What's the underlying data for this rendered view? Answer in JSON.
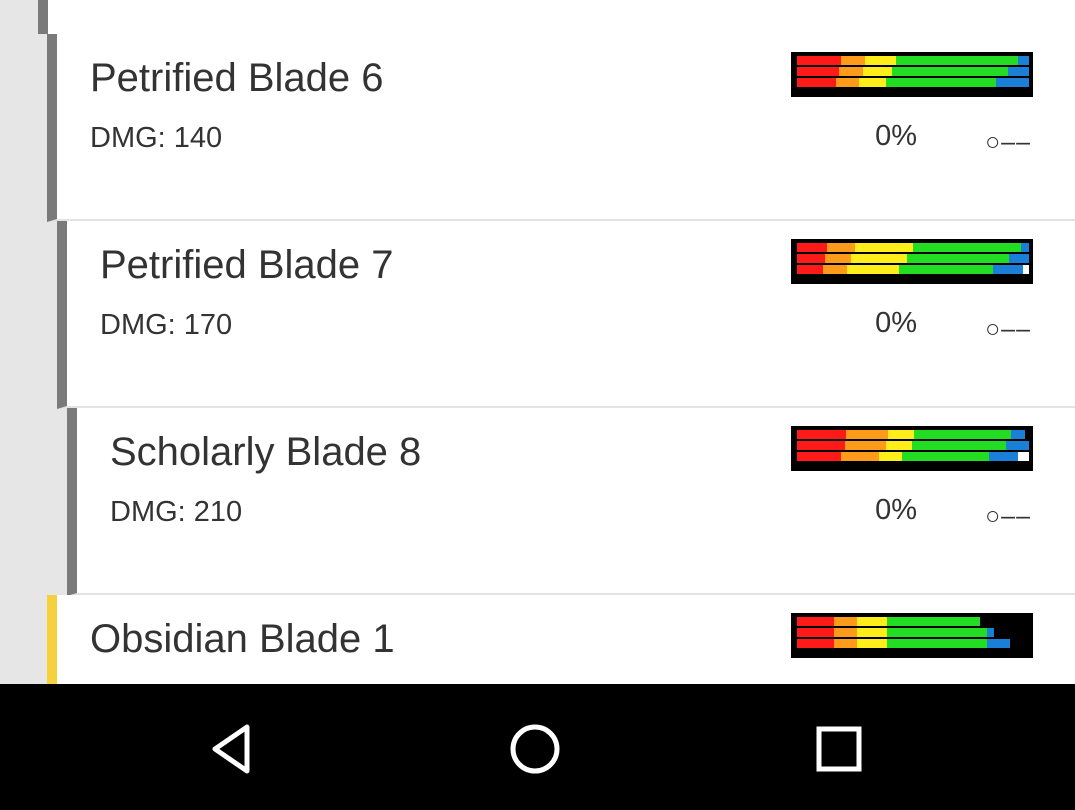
{
  "colors": {
    "red": "#ff1a1a",
    "orange": "#ff9b1a",
    "yellow": "#ffee1a",
    "green": "#22dd22",
    "blue": "#1a7fd6",
    "white": "#ffffff",
    "border_gray": "#7a7a7a",
    "border_yellow": "#f5d23d"
  },
  "items": [
    {
      "name": "Petrified Blade 6",
      "damage": "DMG: 140",
      "percent": "0%",
      "state": "○––",
      "bars": [
        [
          [
            "red",
            0.2
          ],
          [
            "orange",
            0.11
          ],
          [
            "yellow",
            0.14
          ],
          [
            "green",
            0.55
          ],
          [
            "blue",
            0.05
          ]
        ],
        [
          [
            "red",
            0.2
          ],
          [
            "orange",
            0.11
          ],
          [
            "yellow",
            0.14
          ],
          [
            "green",
            0.55
          ],
          [
            "blue",
            0.1
          ]
        ],
        [
          [
            "red",
            0.2
          ],
          [
            "orange",
            0.11
          ],
          [
            "yellow",
            0.14
          ],
          [
            "green",
            0.55
          ],
          [
            "blue",
            0.17
          ]
        ]
      ]
    },
    {
      "name": "Petrified Blade 7",
      "damage": "DMG: 170",
      "percent": "0%",
      "state": "○––",
      "bars": [
        [
          [
            "red",
            0.14
          ],
          [
            "orange",
            0.13
          ],
          [
            "yellow",
            0.27
          ],
          [
            "green",
            0.5
          ],
          [
            "blue",
            0.04
          ]
        ],
        [
          [
            "red",
            0.14
          ],
          [
            "orange",
            0.13
          ],
          [
            "yellow",
            0.27
          ],
          [
            "green",
            0.5
          ],
          [
            "blue",
            0.1
          ]
        ],
        [
          [
            "red",
            0.14
          ],
          [
            "orange",
            0.13
          ],
          [
            "yellow",
            0.27
          ],
          [
            "green",
            0.5
          ],
          [
            "blue",
            0.16
          ],
          [
            "white",
            0.03
          ]
        ]
      ]
    },
    {
      "name": "Scholarly Blade 8",
      "damage": "DMG: 210",
      "percent": "0%",
      "state": "○––",
      "bars": [
        [
          [
            "red",
            0.21
          ],
          [
            "orange",
            0.18
          ],
          [
            "yellow",
            0.11
          ],
          [
            "green",
            0.42
          ],
          [
            "blue",
            0.06
          ]
        ],
        [
          [
            "red",
            0.21
          ],
          [
            "orange",
            0.18
          ],
          [
            "yellow",
            0.11
          ],
          [
            "green",
            0.42
          ],
          [
            "blue",
            0.1
          ]
        ],
        [
          [
            "red",
            0.21
          ],
          [
            "orange",
            0.18
          ],
          [
            "yellow",
            0.11
          ],
          [
            "green",
            0.42
          ],
          [
            "blue",
            0.14
          ],
          [
            "white",
            0.05
          ]
        ]
      ]
    },
    {
      "name": "Obsidian Blade 1",
      "damage": "",
      "percent": "",
      "state": "",
      "bars": [
        [
          [
            "red",
            0.16
          ],
          [
            "orange",
            0.1
          ],
          [
            "yellow",
            0.13
          ],
          [
            "green",
            0.4
          ],
          [
            "blue",
            0.0
          ]
        ],
        [
          [
            "red",
            0.16
          ],
          [
            "orange",
            0.1
          ],
          [
            "yellow",
            0.13
          ],
          [
            "green",
            0.43
          ],
          [
            "blue",
            0.03
          ]
        ],
        [
          [
            "red",
            0.16
          ],
          [
            "orange",
            0.1
          ],
          [
            "yellow",
            0.13
          ],
          [
            "green",
            0.43
          ],
          [
            "blue",
            0.1
          ]
        ]
      ]
    }
  ],
  "navbar": {
    "back_icon": "back-triangle-icon",
    "home_icon": "home-circle-icon",
    "recents_icon": "recents-square-icon"
  }
}
